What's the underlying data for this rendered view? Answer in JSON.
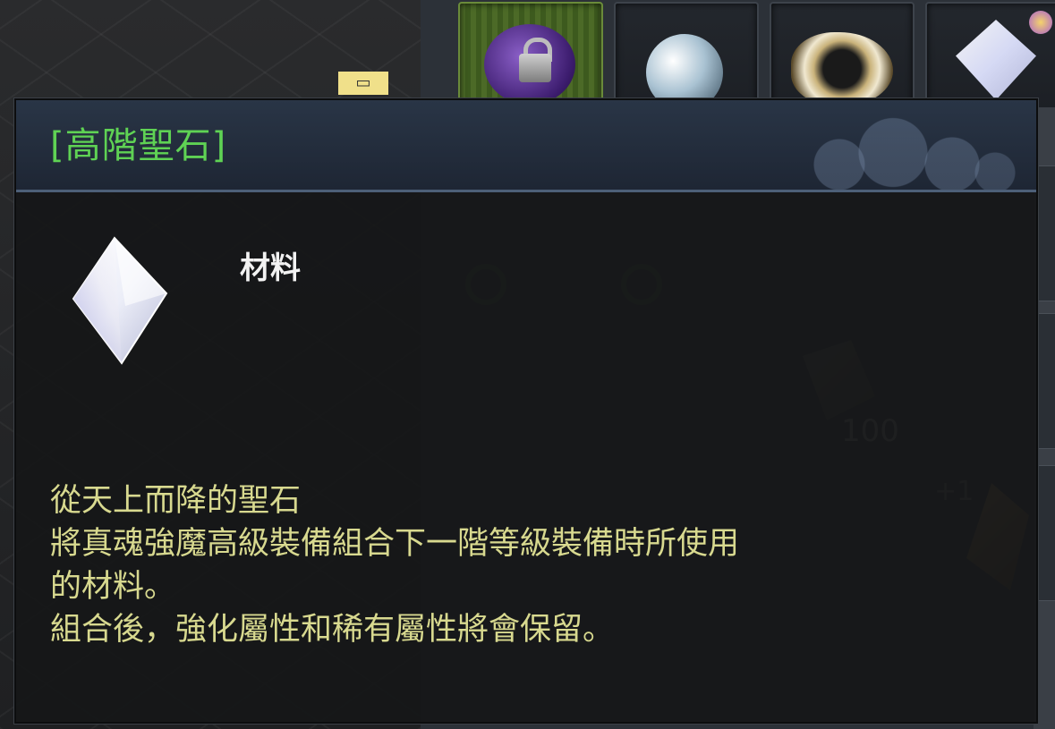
{
  "tooltip": {
    "title": "[高階聖石]",
    "item_type": "材料",
    "description": [
      "從天上而降的聖石",
      "將真魂強魔高級裝備組合下一階等級裝備時所使用",
      "的材料。",
      "組合後，強化屬性和稀有屬性將會保留。"
    ],
    "icon": "crystal-icon"
  },
  "inventory": {
    "ghost_stack_count": "100",
    "ghost_enhance": "+1"
  },
  "colors": {
    "title": "#5fd254",
    "description": "#d8d98f",
    "header_bg": "#293546"
  }
}
